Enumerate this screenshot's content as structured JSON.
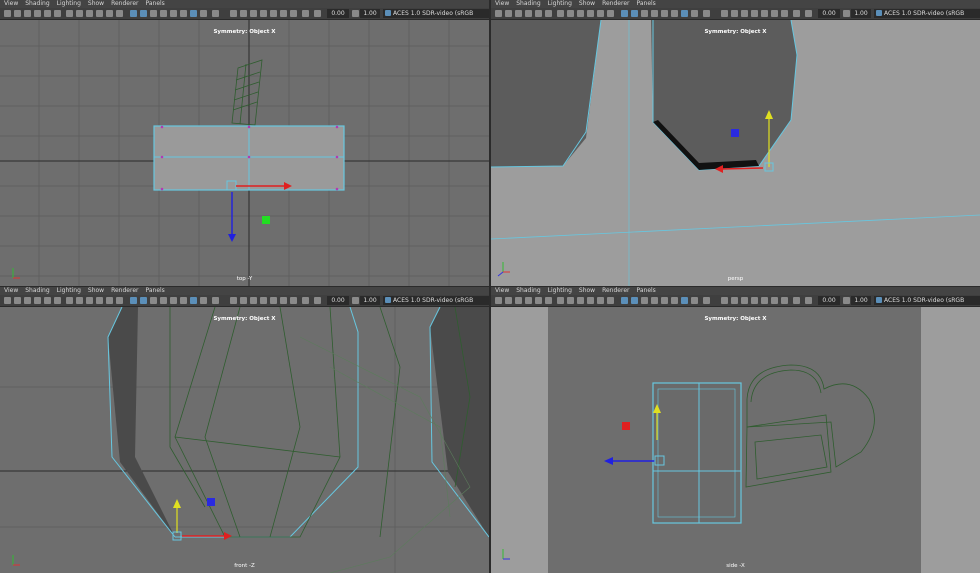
{
  "menu": [
    "View",
    "Shading",
    "Lighting",
    "Show",
    "Renderer",
    "Panels"
  ],
  "toolbar": {
    "field1": "0.00",
    "field2": "1.00",
    "colorspace": "ACES 1.0 SDR-video (sRGB"
  },
  "symmetry_label": "Symmetry: Object X",
  "panels": {
    "top": {
      "camera": "top -Y"
    },
    "persp": {
      "camera": "persp"
    },
    "front": {
      "camera": "front -Z"
    },
    "side": {
      "camera": "side -X"
    }
  },
  "colors": {
    "viewport_bg": "#6b6b6b",
    "selection": "#67c7e0",
    "wire": "#2e5a2e",
    "grid": "#5a5a5a"
  }
}
